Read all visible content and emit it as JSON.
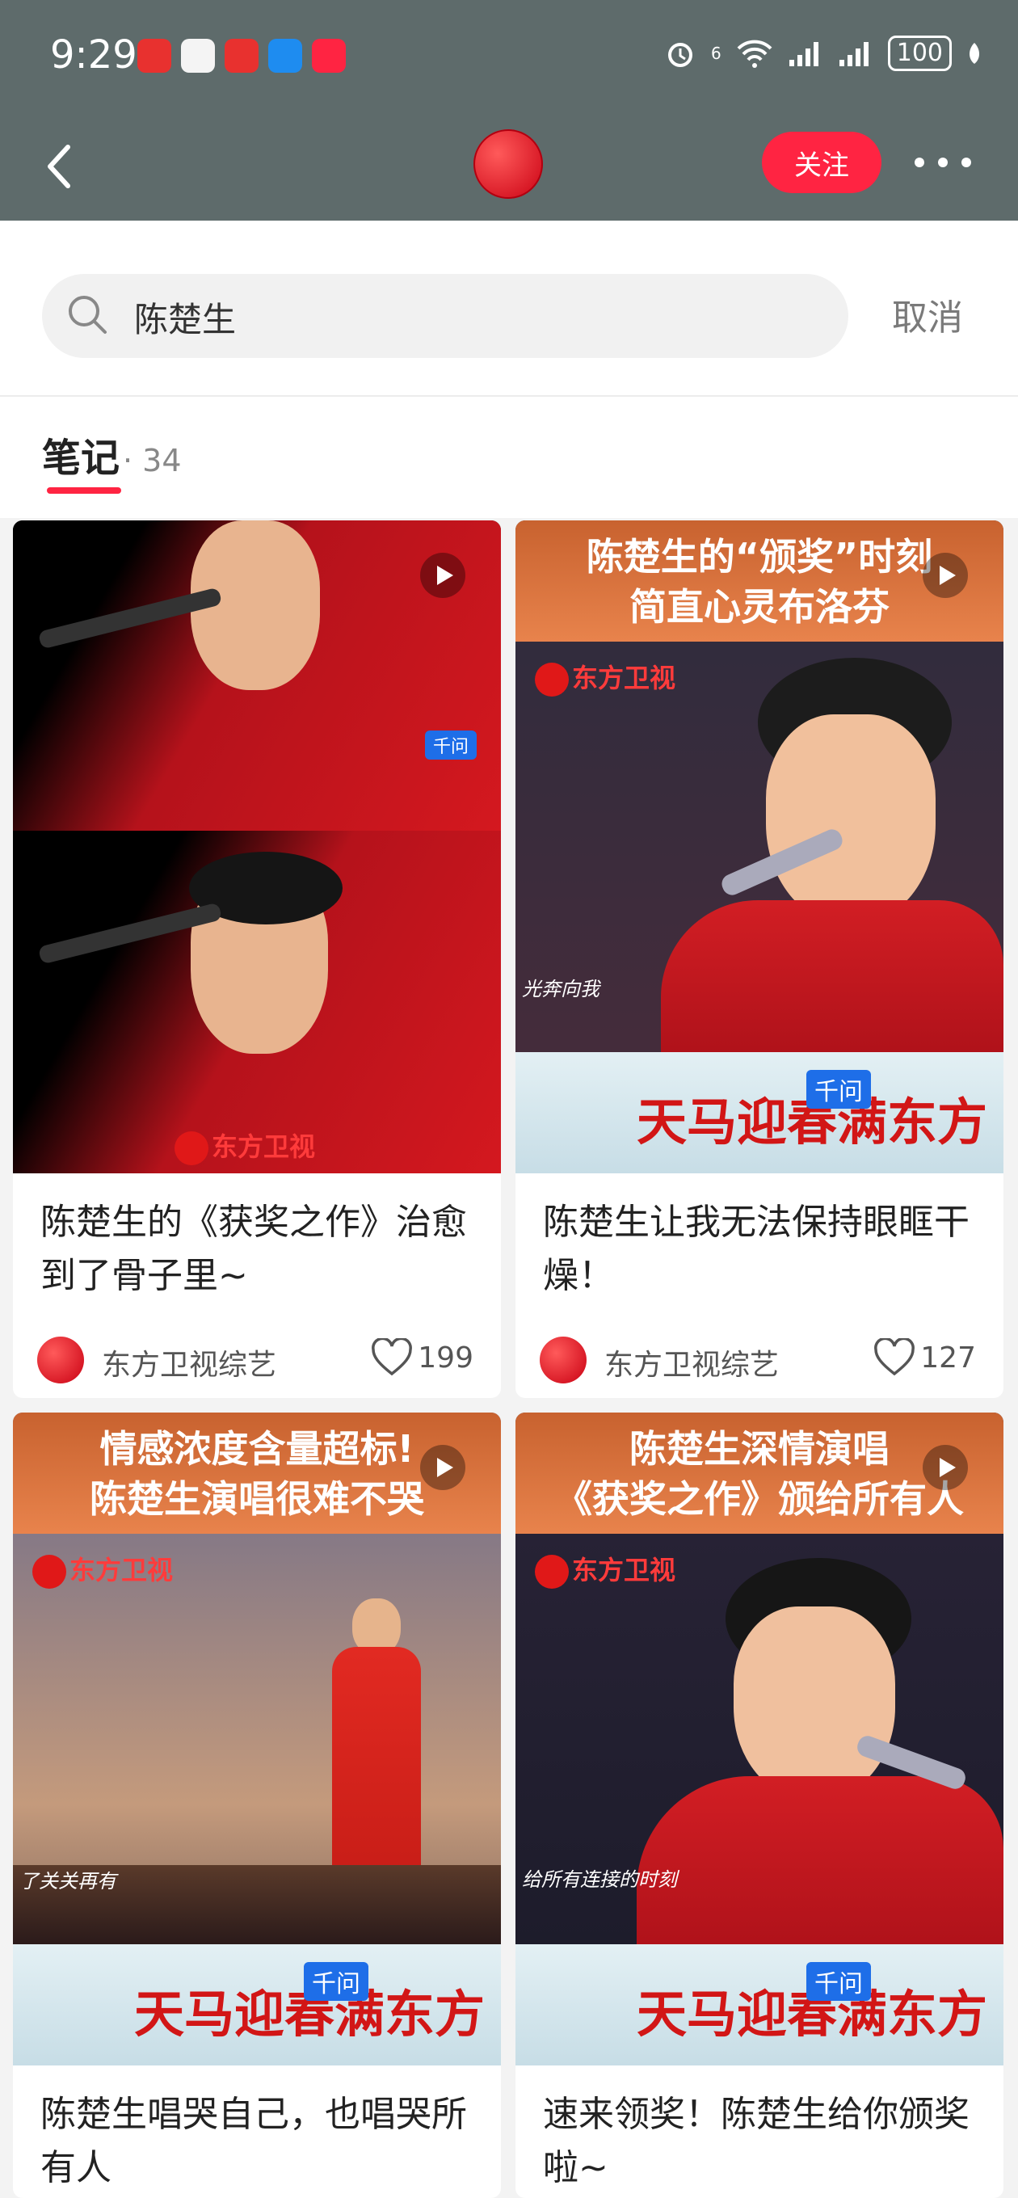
{
  "status": {
    "time": "9:29",
    "network": "6",
    "battery": "100"
  },
  "header": {
    "follow_label": "关注"
  },
  "search": {
    "query": "陈楚生",
    "cancel_label": "取消"
  },
  "tab": {
    "label": "笔记",
    "count": "· 34"
  },
  "cards": [
    {
      "title": "陈楚生的《获奖之作》治愈到了骨子里~",
      "author": "东方卫视综艺",
      "likes": "199",
      "watermark": "东方卫视",
      "badge": "千问"
    },
    {
      "overlay_line1": "陈楚生的“颁奖”时刻",
      "overlay_line2": "简直心灵布洛芬",
      "watermark": "东方卫视",
      "caption": "光奔向我",
      "badge": "千问",
      "title": "陈楚生让我无法保持眼眶干燥！",
      "author": "东方卫视综艺",
      "likes": "127"
    },
    {
      "overlay_line1": "情感浓度含量超标!",
      "overlay_line2": "陈楚生演唱很难不哭",
      "watermark": "东方卫视",
      "caption": "了关关再有",
      "badge": "千问",
      "title": "陈楚生唱哭自己，也唱哭所有人"
    },
    {
      "overlay_line1": "陈楚生深情演唱",
      "overlay_line2": "《获奖之作》颁给所有人",
      "watermark": "东方卫视",
      "caption": "给所有连接的时刻",
      "badge": "千问",
      "title": "速来领奖！陈楚生给你颁奖啦~"
    }
  ],
  "banner_text": "天马迎春满东方",
  "colors": {
    "header_bg": "#5e6b6b",
    "accent": "#ff2442"
  }
}
